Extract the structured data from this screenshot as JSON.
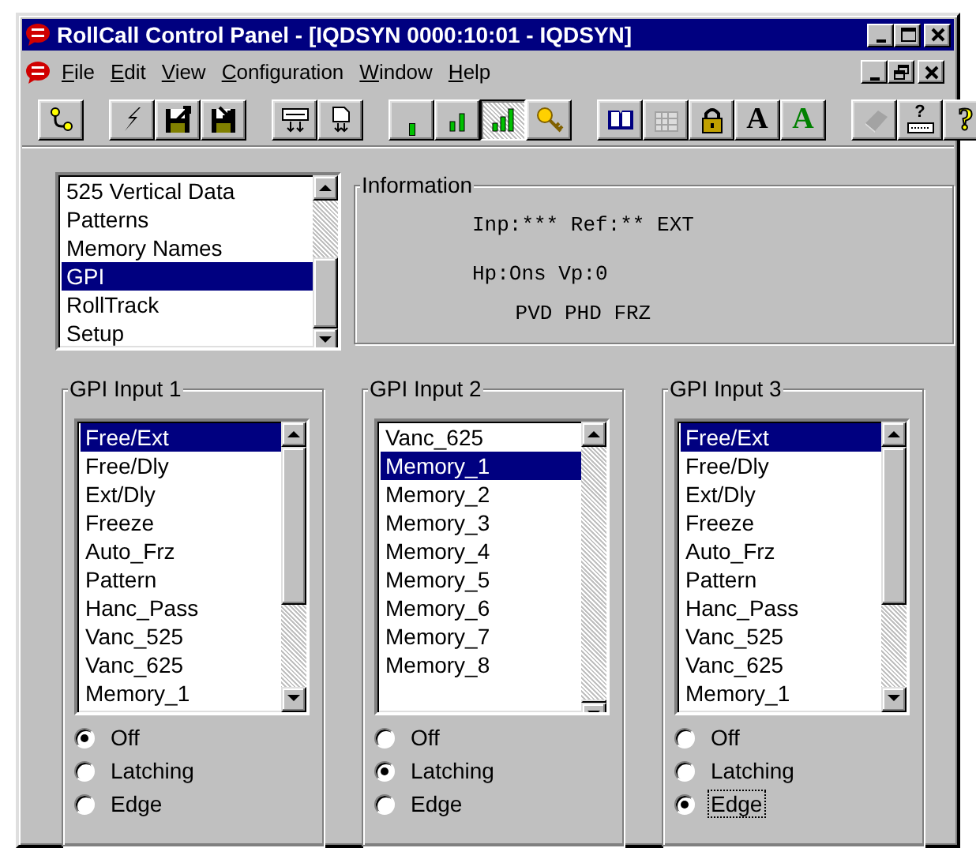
{
  "window": {
    "title": "RollCall Control Panel - [IQDSYN 0000:10:01 - IQDSYN]"
  },
  "menu": [
    {
      "label": "File"
    },
    {
      "label": "Edit"
    },
    {
      "label": "View"
    },
    {
      "label": "Configuration"
    },
    {
      "label": "Window"
    },
    {
      "label": "Help"
    }
  ],
  "toolbar": [
    [
      {
        "kind": "connect",
        "pressed": false,
        "disabled": false
      }
    ],
    [
      {
        "kind": "flash",
        "pressed": false,
        "disabled": false
      },
      {
        "kind": "save-out",
        "pressed": false,
        "disabled": false
      },
      {
        "kind": "save-in",
        "pressed": false,
        "disabled": false
      }
    ],
    [
      {
        "kind": "device-down",
        "pressed": false,
        "disabled": false
      },
      {
        "kind": "page-down",
        "pressed": false,
        "disabled": false
      }
    ],
    [
      {
        "kind": "bars-1",
        "pressed": false,
        "disabled": false
      },
      {
        "kind": "bars-2",
        "pressed": false,
        "disabled": false
      },
      {
        "kind": "bars-3",
        "pressed": true,
        "disabled": false
      },
      {
        "kind": "key",
        "pressed": false,
        "disabled": false
      }
    ],
    [
      {
        "kind": "book",
        "pressed": false,
        "disabled": false
      },
      {
        "kind": "calendar",
        "pressed": false,
        "disabled": true
      },
      {
        "kind": "lock",
        "pressed": false,
        "disabled": false
      },
      {
        "kind": "letter",
        "label": "A",
        "color": "#000000",
        "pressed": false,
        "disabled": false
      },
      {
        "kind": "letter",
        "label": "A",
        "color": "#008000",
        "pressed": false,
        "disabled": false
      }
    ],
    [
      {
        "kind": "closed-book",
        "pressed": false,
        "disabled": true
      },
      {
        "kind": "keyboard-help",
        "label": "?",
        "pressed": false,
        "disabled": false
      },
      {
        "kind": "help",
        "label": "?",
        "pressed": false,
        "disabled": false
      }
    ]
  ],
  "nav_list": [
    {
      "text": "525 Vertical Data",
      "selected": false
    },
    {
      "text": "Patterns",
      "selected": false
    },
    {
      "text": "Memory Names",
      "selected": false
    },
    {
      "text": "GPI",
      "selected": true
    },
    {
      "text": "RollTrack",
      "selected": false
    },
    {
      "text": "Setup",
      "selected": false
    }
  ],
  "information": {
    "title": "Information",
    "lines": [
      {
        "text": "Inp:*** Ref:** EXT"
      },
      {
        "text": "Hp:Ons Vp:0"
      },
      {
        "text": "PVD PHD FRZ"
      }
    ]
  },
  "gpi_inputs": [
    {
      "title": "GPI Input 1",
      "items": [
        {
          "text": "Free/Ext",
          "selected": true
        },
        {
          "text": "Free/Dly",
          "selected": false
        },
        {
          "text": "Ext/Dly",
          "selected": false
        },
        {
          "text": "Freeze",
          "selected": false
        },
        {
          "text": "Auto_Frz",
          "selected": false
        },
        {
          "text": "Pattern",
          "selected": false
        },
        {
          "text": "Hanc_Pass",
          "selected": false
        },
        {
          "text": "Vanc_525",
          "selected": false
        },
        {
          "text": "Vanc_625",
          "selected": false
        },
        {
          "text": "Memory_1",
          "selected": false
        }
      ],
      "modes": [
        {
          "label": "Off",
          "selected": true,
          "focused": false
        },
        {
          "label": "Latching",
          "selected": false,
          "focused": false
        },
        {
          "label": "Edge",
          "selected": false,
          "focused": false
        }
      ]
    },
    {
      "title": "GPI Input 2",
      "items": [
        {
          "text": "Vanc_625",
          "selected": false
        },
        {
          "text": "Memory_1",
          "selected": true
        },
        {
          "text": "Memory_2",
          "selected": false
        },
        {
          "text": "Memory_3",
          "selected": false
        },
        {
          "text": "Memory_4",
          "selected": false
        },
        {
          "text": "Memory_5",
          "selected": false
        },
        {
          "text": "Memory_6",
          "selected": false
        },
        {
          "text": "Memory_7",
          "selected": false
        },
        {
          "text": "Memory_8",
          "selected": false
        }
      ],
      "modes": [
        {
          "label": "Off",
          "selected": false,
          "focused": false
        },
        {
          "label": "Latching",
          "selected": true,
          "focused": false
        },
        {
          "label": "Edge",
          "selected": false,
          "focused": false
        }
      ]
    },
    {
      "title": "GPI Input 3",
      "items": [
        {
          "text": "Free/Ext",
          "selected": true
        },
        {
          "text": "Free/Dly",
          "selected": false
        },
        {
          "text": "Ext/Dly",
          "selected": false
        },
        {
          "text": "Freeze",
          "selected": false
        },
        {
          "text": "Auto_Frz",
          "selected": false
        },
        {
          "text": "Pattern",
          "selected": false
        },
        {
          "text": "Hanc_Pass",
          "selected": false
        },
        {
          "text": "Vanc_525",
          "selected": false
        },
        {
          "text": "Vanc_625",
          "selected": false
        },
        {
          "text": "Memory_1",
          "selected": false
        }
      ],
      "modes": [
        {
          "label": "Off",
          "selected": false,
          "focused": false
        },
        {
          "label": "Latching",
          "selected": false,
          "focused": false
        },
        {
          "label": "Edge",
          "selected": true,
          "focused": true
        }
      ]
    }
  ]
}
